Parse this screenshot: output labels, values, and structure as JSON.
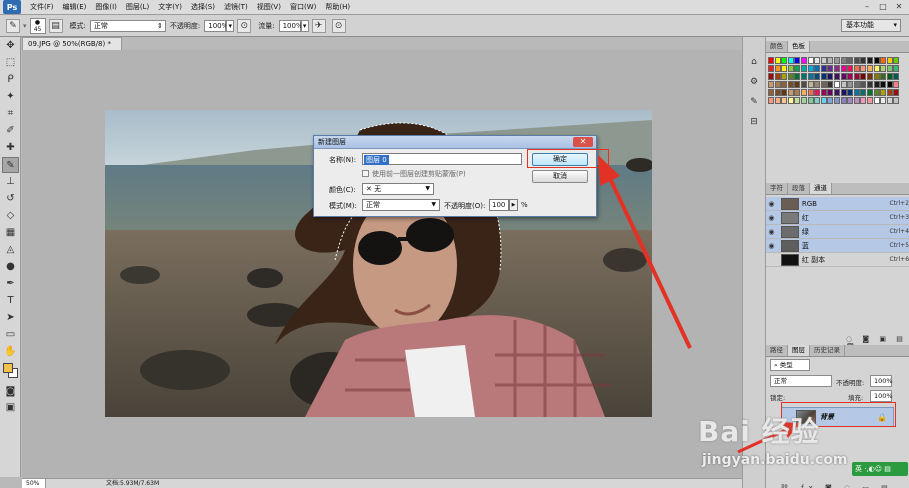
{
  "app": {
    "logo": "Ps"
  },
  "menu": [
    "文件(F)",
    "编辑(E)",
    "图像(I)",
    "图层(L)",
    "文字(Y)",
    "选择(S)",
    "滤镜(T)",
    "视图(V)",
    "窗口(W)",
    "帮助(H)"
  ],
  "options": {
    "brush_size": "45",
    "mode_label": "模式:",
    "mode_value": "正常",
    "opacity_label": "不透明度:",
    "opacity_value": "100%",
    "flow_label": "流量:",
    "flow_value": "100%",
    "workspace": "基本功能"
  },
  "document": {
    "tab_title": "09.JPG @ 50%(RGB/8) *",
    "zoom": "50%",
    "doc_info": "文档:5.93M/7.63M"
  },
  "dialog": {
    "title": "新建图层",
    "name_label": "名称(N):",
    "name_value": "图层 0",
    "clip_label": "使用前一图层创建剪贴蒙版(P)",
    "color_label": "颜色(C):",
    "color_value": "无",
    "mode_label": "模式(M):",
    "mode_value": "正常",
    "opacity_label": "不透明度(O):",
    "opacity_value": "100",
    "opacity_unit": "%",
    "ok_label": "确定",
    "cancel_label": "取消",
    "close_glyph": "✕"
  },
  "swatches_panel": {
    "tabs": [
      "颜色",
      "色板"
    ],
    "active": 1
  },
  "channels_panel": {
    "tabs": [
      "字符",
      "段落",
      "通道"
    ],
    "active": 2,
    "rows": [
      {
        "name": "RGB",
        "key": "Ctrl+2",
        "visible": true,
        "selected": true
      },
      {
        "name": "红",
        "key": "Ctrl+3",
        "visible": true,
        "selected": true
      },
      {
        "name": "绿",
        "key": "Ctrl+4",
        "visible": true,
        "selected": true
      },
      {
        "name": "蓝",
        "key": "Ctrl+5",
        "visible": true,
        "selected": true
      },
      {
        "name": "红 副本",
        "key": "Ctrl+6",
        "visible": false,
        "selected": false
      }
    ]
  },
  "layers_panel": {
    "tabs": [
      "路径",
      "图层",
      "历史记录"
    ],
    "active": 1,
    "filter_value": "类型",
    "blend_value": "正常",
    "opacity_label": "不透明度:",
    "opacity_value": "100%",
    "fill_label": "填充:",
    "fill_value": "100%",
    "lock_label": "锁定:",
    "layer_name": "背景"
  },
  "watermark": {
    "brand": "Bai 经验",
    "url": "jingyan.baidu.com"
  },
  "ime": "英 ·,◐☺ ▤",
  "colors": {
    "accent": "#e23226",
    "selection": "#b5c8e6",
    "fg": "#f3c24e"
  }
}
